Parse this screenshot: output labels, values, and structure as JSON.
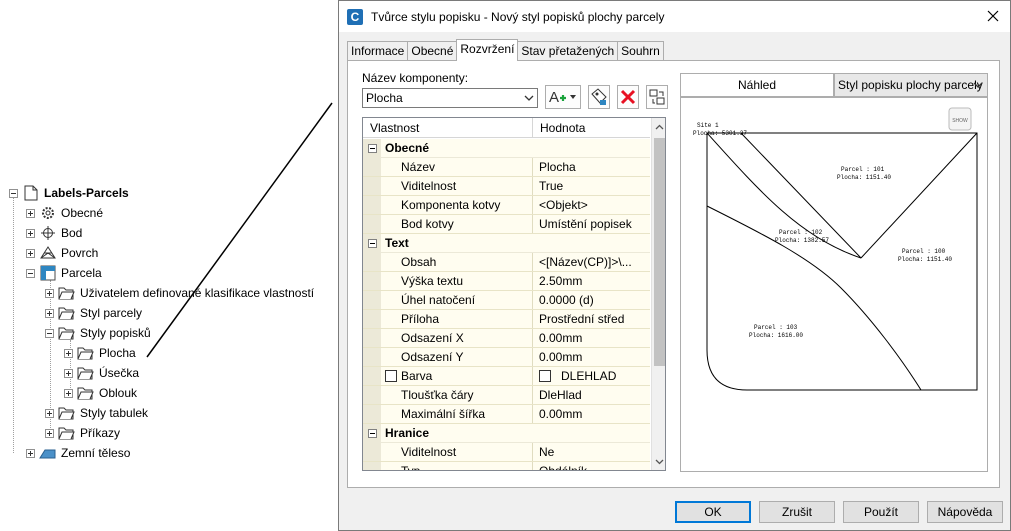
{
  "tree": {
    "root": "Labels-Parcels",
    "items": [
      {
        "label": "Obecné"
      },
      {
        "label": "Bod"
      },
      {
        "label": "Povrch"
      },
      {
        "label": "Parcela"
      },
      {
        "label": "Uživatelem definované klasifikace vlastností"
      },
      {
        "label": "Styl parcely"
      },
      {
        "label": "Styly popisků"
      },
      {
        "label": "Plocha"
      },
      {
        "label": "Úsečka"
      },
      {
        "label": "Oblouk"
      },
      {
        "label": "Styly tabulek"
      },
      {
        "label": "Příkazy"
      },
      {
        "label": "Zemní těleso"
      }
    ]
  },
  "dialog": {
    "app_icon": "C",
    "title": "Tvůrce stylu popisku - Nový styl popisků plochy parcely",
    "tabs": [
      "Informace",
      "Obecné",
      "Rozvržení",
      "Stav přetažených",
      "Souhrn"
    ],
    "active_tab": "Rozvržení",
    "component_label": "Název komponenty:",
    "component_value": "Plocha",
    "grid": {
      "col_property": "Vlastnost",
      "col_value": "Hodnota",
      "rows": [
        {
          "type": "cat",
          "name": "Obecné"
        },
        {
          "name": "Název",
          "value": "Plocha"
        },
        {
          "name": "Viditelnost",
          "value": "True"
        },
        {
          "name": "Komponenta kotvy",
          "value": "<Objekt>"
        },
        {
          "name": "Bod kotvy",
          "value": "Umístění popisek"
        },
        {
          "type": "cat",
          "name": "Text"
        },
        {
          "name": "Obsah",
          "value": "<[Název(CP)]>\\..."
        },
        {
          "name": "Výška textu",
          "value": "2.50mm"
        },
        {
          "name": "Úhel natočení",
          "value": "0.0000 (d)"
        },
        {
          "name": "Příloha",
          "value": "Prostřední střed"
        },
        {
          "name": "Odsazení X",
          "value": "0.00mm"
        },
        {
          "name": "Odsazení Y",
          "value": "0.00mm"
        },
        {
          "name": "Barva",
          "value": "DLEHLAD",
          "checkbox": true
        },
        {
          "name": "Tloušťka čáry",
          "value": "DleHlad"
        },
        {
          "name": "Maximální šířka",
          "value": "0.00mm"
        },
        {
          "type": "cat",
          "name": "Hranice"
        },
        {
          "name": "Viditelnost",
          "value": "Ne"
        },
        {
          "name": "Typ",
          "value": "Obdélník"
        }
      ]
    },
    "preview": {
      "label": "Náhled",
      "style": "Styl popisku plochy parcely",
      "site_label": "Site 1",
      "site_area": "Plocha: 5301.37",
      "parcels": [
        {
          "name": "Parcel : 101",
          "area": "Plocha: 1151.40"
        },
        {
          "name": "Parcel : 102",
          "area": "Plocha: 1382.57"
        },
        {
          "name": "Parcel : 100",
          "area": "Plocha: 1151.40"
        },
        {
          "name": "Parcel : 103",
          "area": "Plocha: 1616.00"
        }
      ],
      "badge": "SHOW"
    },
    "buttons": {
      "ok": "OK",
      "cancel": "Zrušit",
      "apply": "Použít",
      "help": "Nápověda"
    }
  },
  "colors": {
    "accent": "#0078d7",
    "delete": "#e81123",
    "grid_bg": "#fffdf0",
    "grid_cat": "#ece9d8"
  }
}
